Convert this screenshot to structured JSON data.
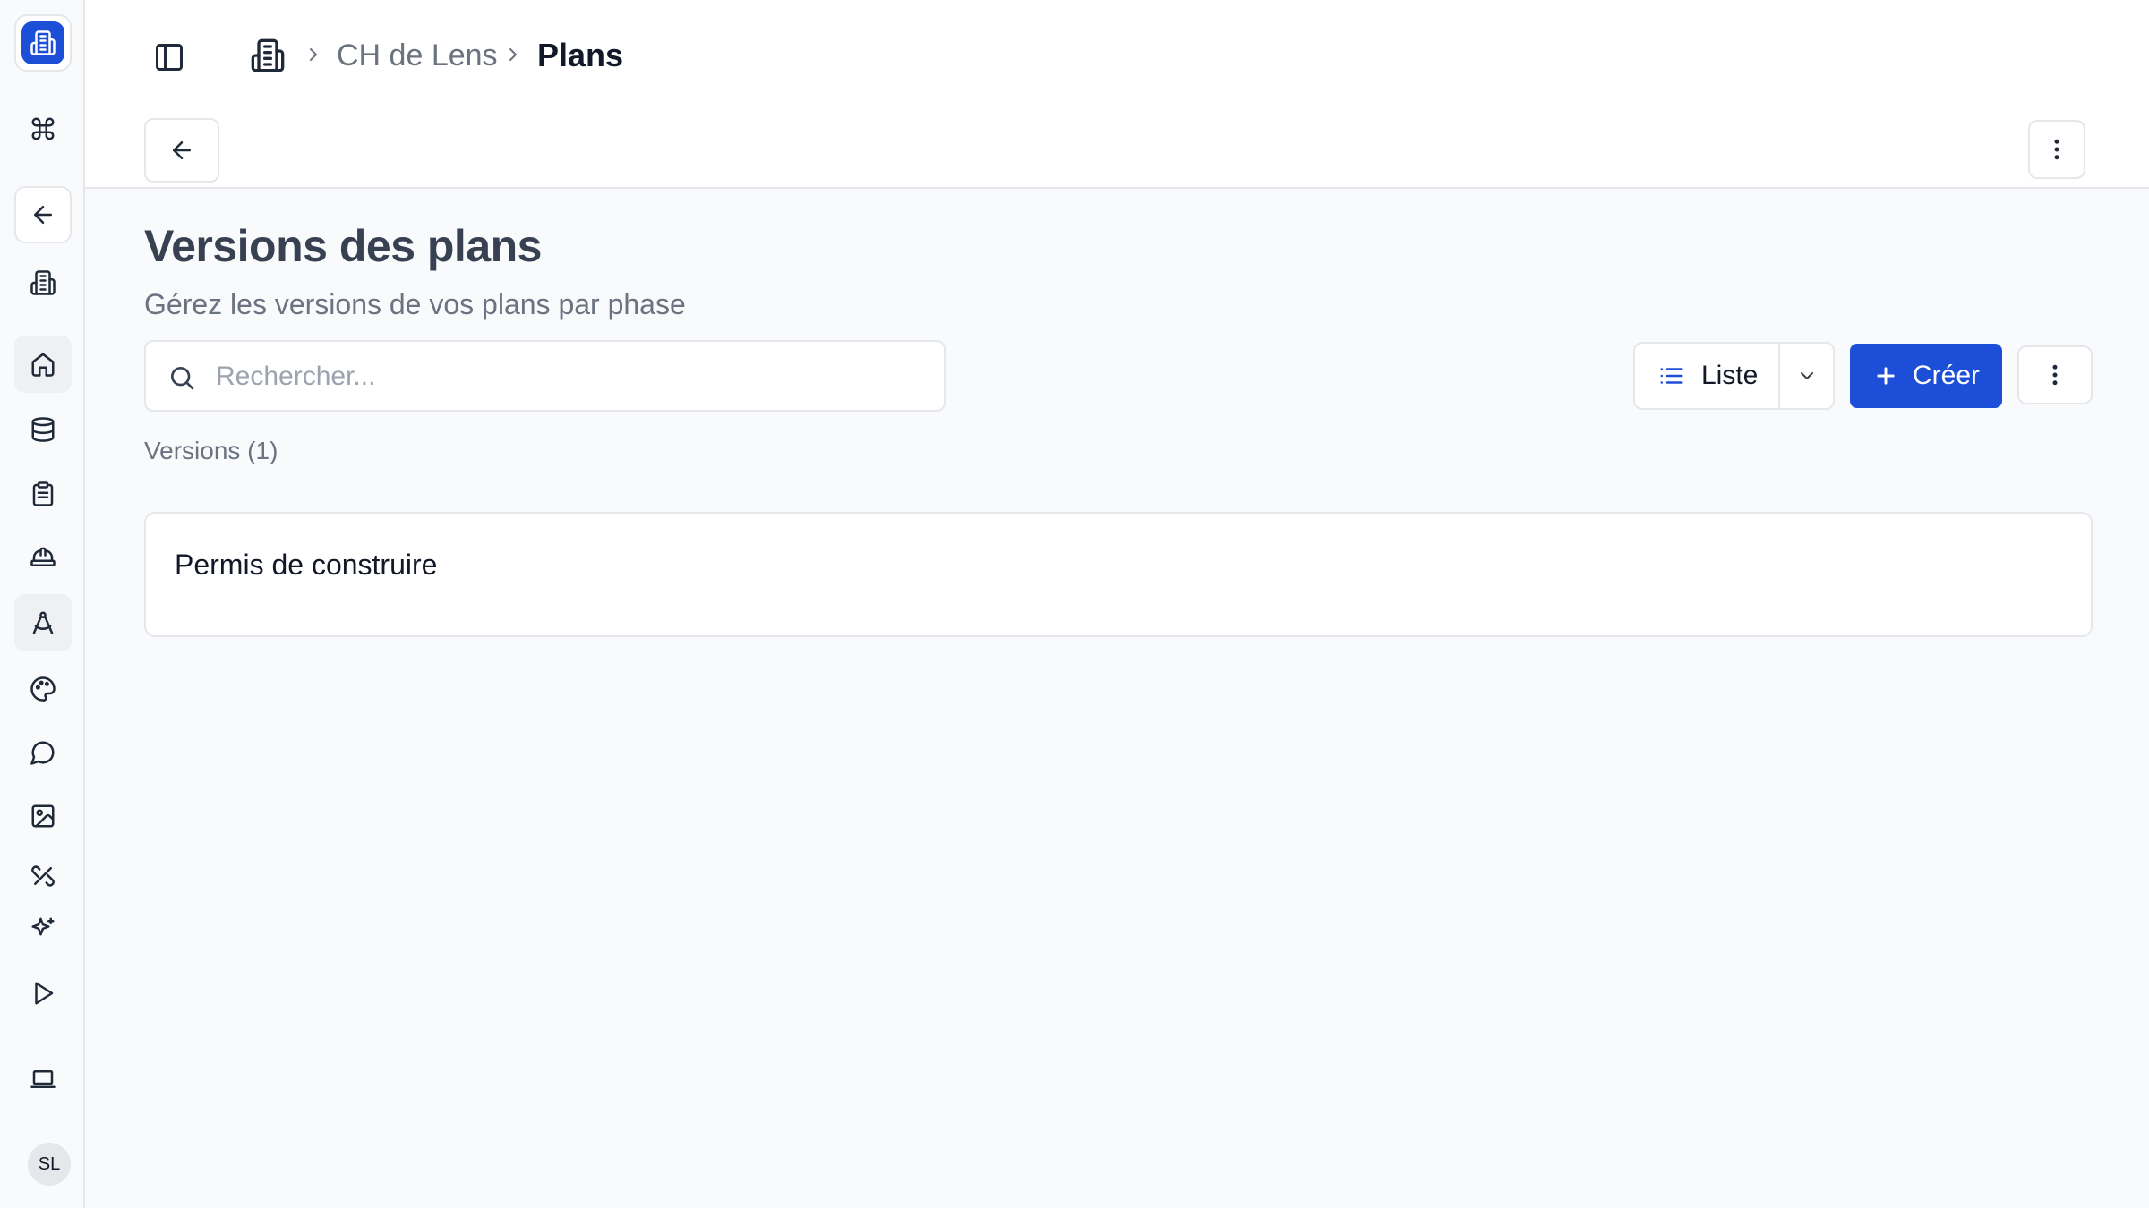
{
  "sidebar": {
    "items": [
      {
        "icon": "command-icon"
      },
      {
        "icon": "arrow-left-icon"
      },
      {
        "icon": "building-icon"
      },
      {
        "icon": "home-icon"
      },
      {
        "icon": "database-icon"
      },
      {
        "icon": "clipboard-icon"
      },
      {
        "icon": "hard-hat-icon"
      },
      {
        "icon": "compass-drafting-icon"
      },
      {
        "icon": "palette-icon"
      },
      {
        "icon": "message-circle-icon"
      },
      {
        "icon": "image-icon"
      },
      {
        "icon": "tools-icon"
      },
      {
        "icon": "sparkles-icon"
      },
      {
        "icon": "play-icon"
      },
      {
        "icon": "laptop-icon"
      }
    ],
    "user_initials": "SL"
  },
  "breadcrumb": {
    "parent": "CH de Lens",
    "current": "Plans"
  },
  "page": {
    "title": "Versions des plans",
    "subtitle": "Gérez les versions de vos plans par phase"
  },
  "search": {
    "placeholder": "Rechercher...",
    "value": ""
  },
  "toolbar": {
    "view_label": "Liste",
    "create_label": "Créer"
  },
  "versions": {
    "count_label": "Versions (1)",
    "items": [
      {
        "title": "Permis de construire"
      }
    ]
  },
  "colors": {
    "accent": "#1d4ed8",
    "background": "#f9fafc",
    "border": "#e5e7eb"
  }
}
